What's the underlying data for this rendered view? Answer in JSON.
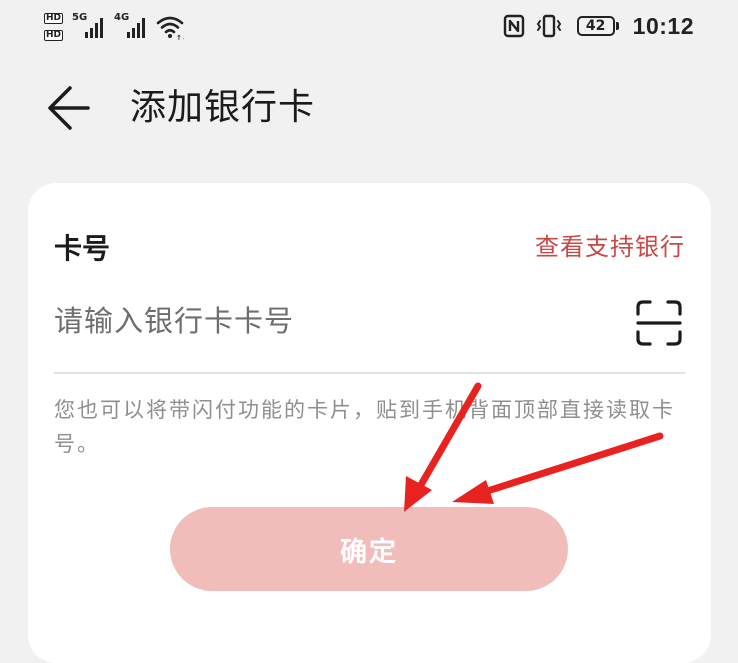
{
  "status_bar": {
    "hd1": "HD",
    "hd2": "HD",
    "network1": "5G",
    "network2": "4G",
    "battery": "42",
    "time": "10:12"
  },
  "header": {
    "title": "添加银行卡",
    "back_icon": "arrow-left-icon"
  },
  "card": {
    "label": "卡号",
    "support_link": "查看支持银行",
    "input_placeholder": "请输入银行卡卡号",
    "input_value": "",
    "scan_icon": "scan-icon",
    "hint": "您也可以将带闪付功能的卡片，贴到手机背面顶部直接读取卡号。",
    "confirm_label": "确定"
  },
  "colors": {
    "link": "#c94747",
    "button_disabled": "#f1bdbb",
    "annotation_arrow": "#e8231f"
  }
}
